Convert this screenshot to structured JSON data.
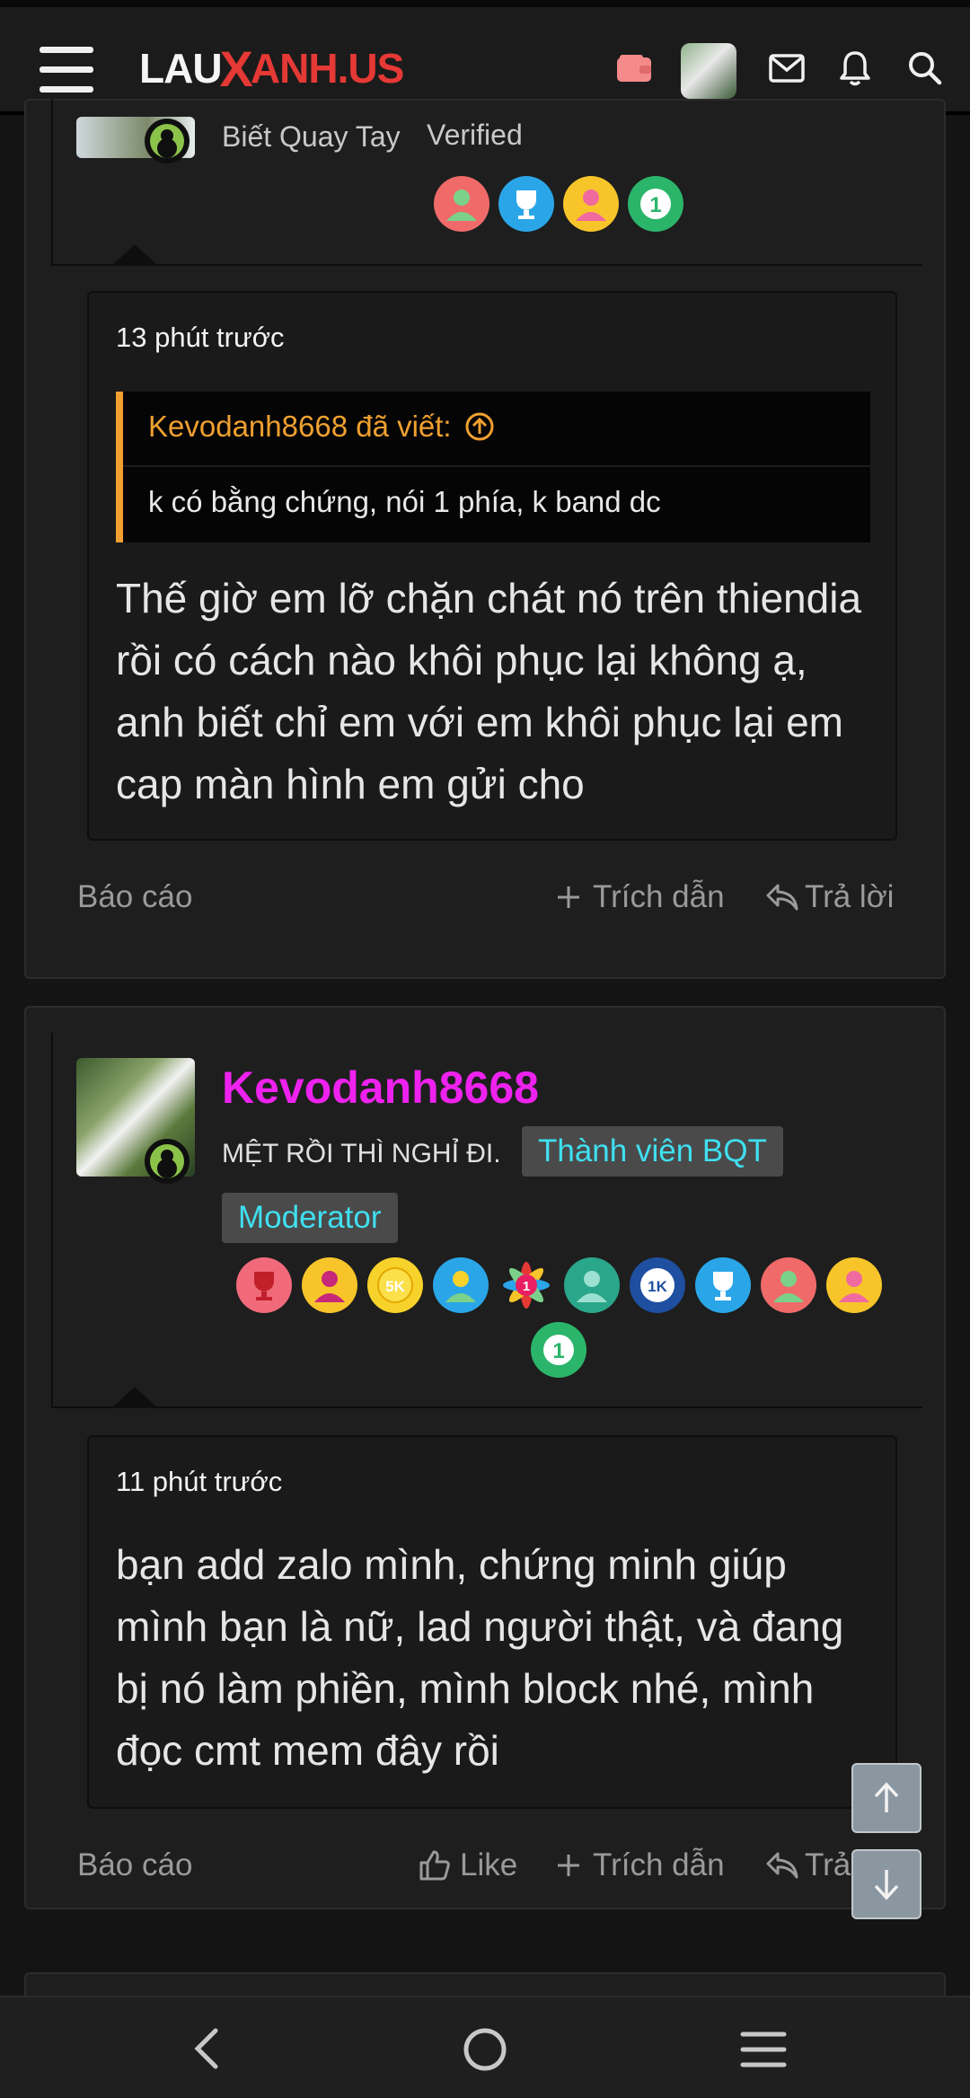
{
  "header": {
    "logo_left": "LAU",
    "logo_mid": "X",
    "logo_right": "ANH.US"
  },
  "post1": {
    "user_title": "Biết Quay Tay",
    "user_badge": "Verified",
    "time": "13 phút trước",
    "quote_author": "Kevodanh8668 đã viết:",
    "quote_text": "k có bằng chứng, nói 1 phía, k band dc",
    "body": "Thế giờ em lỡ chặn chát nó trên thiendia rồi có cách nào khôi phục lại không ạ, anh biết chỉ em với em khôi phục lại em cap màn hình em gửi cho",
    "report": "Báo cáo",
    "quote_action": "Trích dẫn",
    "reply_action": "Trả lời"
  },
  "post2": {
    "username": "Kevodanh8668",
    "user_title": "MỆT RỒI THÌ NGHỈ ĐI.",
    "role1": "Thành viên BQT",
    "role2": "Moderator",
    "time": "11 phút trước",
    "body": "bạn add zalo mình, chứng minh giúp mình bạn là nữ, lad người thật, và đang bị nó làm phiền, mình block nhé, mình đọc cmt mem đây rồi",
    "report": "Báo cáo",
    "like_action": "Like",
    "quote_action": "Trích dẫn",
    "reply_action": "Trả lời"
  },
  "trophy_labels": {
    "five_k": "5K",
    "one_k": "1K",
    "one": "1"
  },
  "colors": {
    "accent_orange": "#f0a030",
    "username_magenta": "#ee22ee",
    "role_cyan": "#3fe0f0",
    "online_green": "#8bc34a",
    "logo_red": "#e53935"
  }
}
